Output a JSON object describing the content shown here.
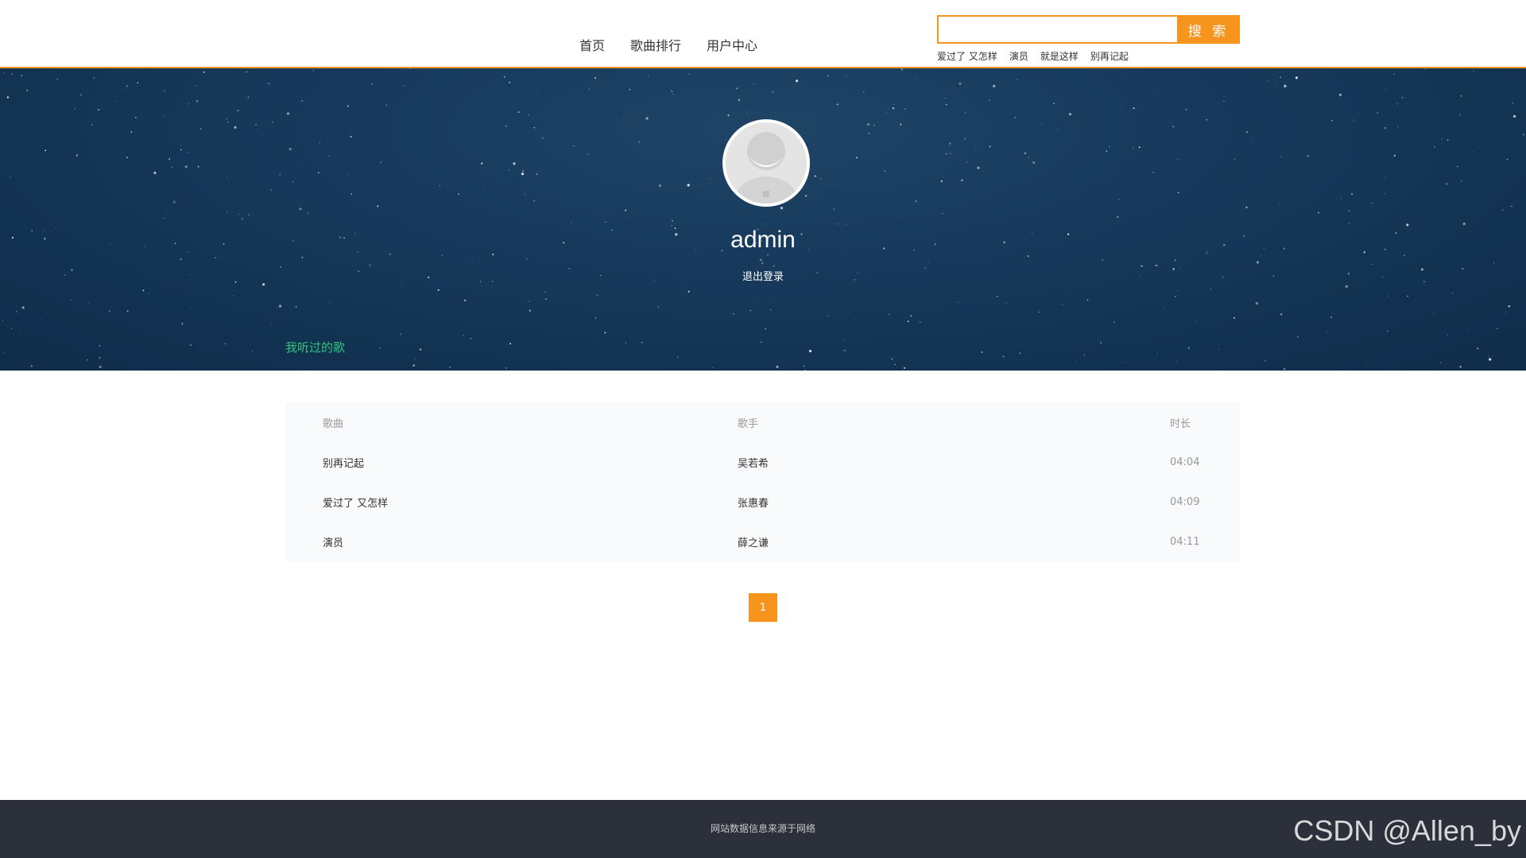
{
  "nav": {
    "items": [
      "首页",
      "歌曲排行",
      "用户中心"
    ]
  },
  "search": {
    "placeholder": "",
    "value": "",
    "button_label": "搜 索",
    "hot_keywords": [
      "爱过了 又怎样",
      "演员",
      "就是这样",
      "别再记起"
    ]
  },
  "profile": {
    "username": "admin",
    "logout_label": "退出登录",
    "tab_label": "我听过的歌"
  },
  "table": {
    "headers": {
      "song": "歌曲",
      "singer": "歌手",
      "duration": "时长"
    },
    "rows": [
      {
        "song": "别再记起",
        "singer": "吴若希",
        "duration": "04:04"
      },
      {
        "song": "爱过了 又怎样",
        "singer": "张惠春",
        "duration": "04:09"
      },
      {
        "song": "演员",
        "singer": "薛之谦",
        "duration": "04:11"
      }
    ]
  },
  "pagination": {
    "current": "1"
  },
  "footer": {
    "text": "网站数据信息来源于网络",
    "watermark": "CSDN @Allen_by"
  },
  "colors": {
    "accent": "#f7941d",
    "green": "#31c27c",
    "footer_bg": "#2b303b",
    "banner_bg": "#173a5c"
  },
  "icons": {
    "avatar": "default-user-avatar"
  }
}
